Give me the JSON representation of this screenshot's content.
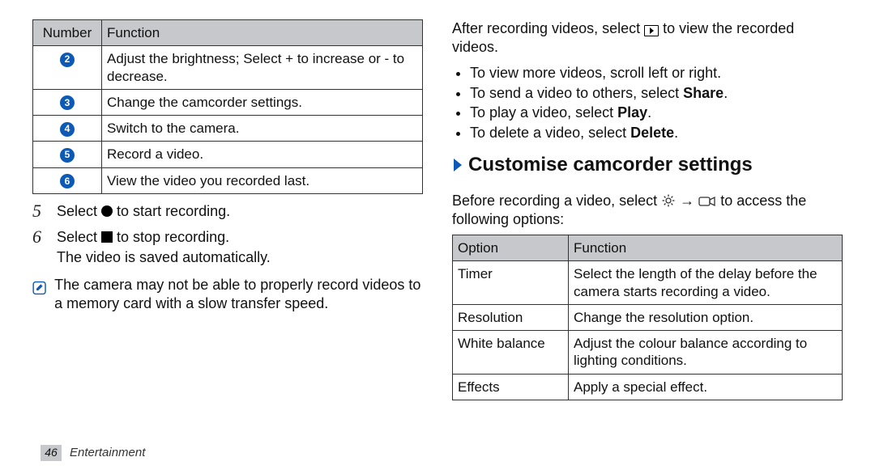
{
  "left": {
    "table_head": {
      "number": "Number",
      "function": "Function"
    },
    "rows": [
      {
        "n": "2",
        "fn": "Adjust the brightness; Select + to increase or - to decrease."
      },
      {
        "n": "3",
        "fn": "Change the camcorder settings."
      },
      {
        "n": "4",
        "fn": "Switch to the camera."
      },
      {
        "n": "5",
        "fn": "Record a video."
      },
      {
        "n": "6",
        "fn": "View the video you recorded last."
      }
    ],
    "step5_num": "5",
    "step5_a": "Select ",
    "step5_b": " to start recording.",
    "step6_num": "6",
    "step6_a": "Select ",
    "step6_b": " to stop recording.",
    "step6_sub": "The video is saved automatically.",
    "note": "The camera may not be able to properly record videos to a memory card with a slow transfer speed."
  },
  "right": {
    "after_a": "After recording videos, select ",
    "after_b": " to view the recorded videos.",
    "bullets": {
      "b1": "To view more videos, scroll left or right.",
      "b2a": "To send a video to others, select ",
      "b2b": "Share",
      "b2c": ".",
      "b3a": "To play a video, select ",
      "b3b": "Play",
      "b3c": ".",
      "b4a": "To delete a video, select ",
      "b4b": "Delete",
      "b4c": "."
    },
    "section_title": "Customise camcorder settings",
    "section_desc_a": "Before recording a video, select ",
    "section_desc_mid": " → ",
    "section_desc_b": " to access the following options:",
    "table_head": {
      "option": "Option",
      "function": "Function"
    },
    "rows": [
      {
        "opt": "Timer",
        "fn": "Select the length of the delay before the camera starts recording a video."
      },
      {
        "opt": "Resolution",
        "fn": "Change the resolution option."
      },
      {
        "opt": "White balance",
        "fn": "Adjust the colour balance according to lighting conditions."
      },
      {
        "opt": "Effects",
        "fn": "Apply a special effect."
      }
    ]
  },
  "footer": {
    "page": "46",
    "section": "Entertainment"
  }
}
